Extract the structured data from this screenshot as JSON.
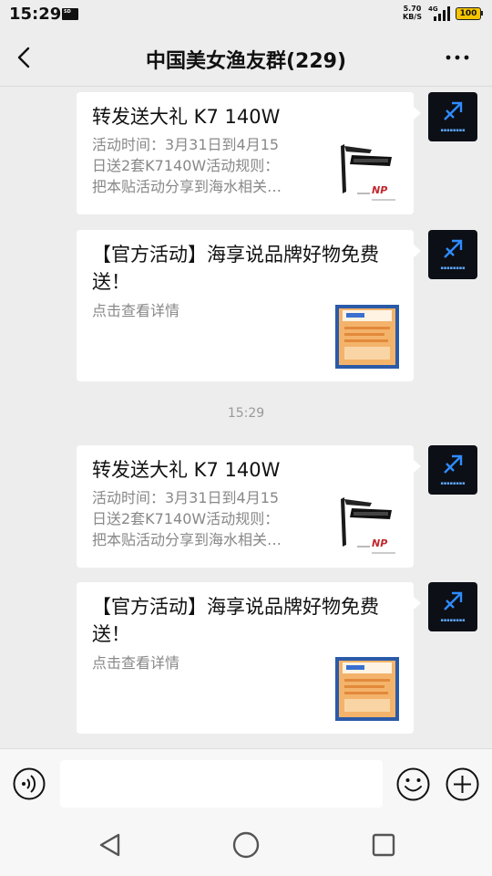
{
  "status": {
    "time": "15:29",
    "speed_value": "5.70",
    "speed_unit": "KB/S",
    "network": "4G",
    "battery": "100"
  },
  "header": {
    "title": "中国美女渔友群(229)"
  },
  "messages": [
    {
      "title": "转发送大礼 K7 140W",
      "desc_lines": [
        "活动时间：3月31日到4月15",
        "日送2套K7140W活动规则：",
        "把本贴活动分享到海水相关…"
      ],
      "thumb": "lamp-thumbnail",
      "thumb_brand": "NP"
    },
    {
      "title": "【官方活动】海享说品牌好物免费送！",
      "desc_lines": [
        "点击查看详情"
      ],
      "thumb": "poster-thumbnail"
    },
    {
      "title": "转发送大礼 K7 140W",
      "desc_lines": [
        "活动时间：3月31日到4月15",
        "日送2套K7140W活动规则：",
        "把本贴活动分享到海水相关…"
      ],
      "thumb": "lamp-thumbnail",
      "thumb_brand": "NP"
    },
    {
      "title": "【官方活动】海享说品牌好物免费送！",
      "desc_lines": [
        "点击查看详情"
      ],
      "thumb": "poster-thumbnail"
    }
  ],
  "timestamp": "15:29",
  "input": {
    "value": "",
    "placeholder": ""
  },
  "colors": {
    "background": "#ededed",
    "bubble": "#ffffff",
    "avatar_bg": "#0c0f16",
    "avatar_accent": "#2f8cff",
    "battery": "#f5c500"
  },
  "icons": {
    "back": "chevron-left-icon",
    "more": "more-dots-icon",
    "voice": "voice-icon",
    "emoji": "emoji-icon",
    "plus": "plus-icon",
    "nav_back": "nav-back-icon",
    "nav_home": "nav-home-icon",
    "nav_recent": "nav-recent-icon"
  }
}
